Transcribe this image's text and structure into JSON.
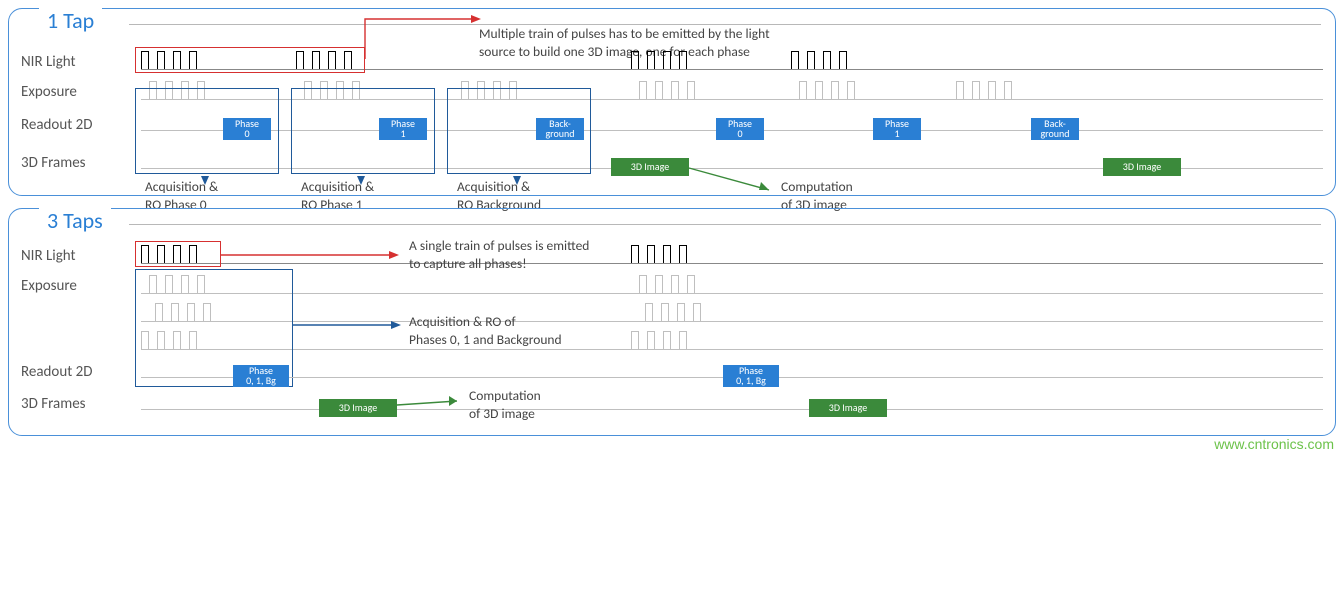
{
  "panel1": {
    "title": "1 Tap",
    "rows": {
      "nir": "NIR Light",
      "exp": "Exposure",
      "ro2d": "Readout 2D",
      "frames": "3D Frames"
    },
    "phase_labels": {
      "p0": "Phase\n0",
      "p1": "Phase\n1",
      "bg": "Back-\nground",
      "p0b": "Phase\n0",
      "p1b": "Phase\n1",
      "bgb": "Back-\nground"
    },
    "acq": {
      "a0": "Acquisition &\nRO Phase 0",
      "a1": "Acquisition &\nRO Phase 1",
      "a2": "Acquisition &\nRO Background"
    },
    "img3d": "3D Image",
    "callout_red": "Multiple train of pulses has to be emitted by the light\nsource to build one 3D image, one for each phase",
    "callout_comp": "Computation\nof 3D image"
  },
  "panel2": {
    "title": "3 Taps",
    "rows": {
      "nir": "NIR Light",
      "exp": "Exposure",
      "ro2d": "Readout 2D",
      "frames": "3D Frames"
    },
    "phase_label": "Phase\n0, 1, Bg",
    "callout_red": "A single train of pulses is emitted\nto capture all phases!",
    "acq_callout": "Acquisition & RO of\nPhases 0, 1 and Background",
    "img3d": "3D Image",
    "callout_comp": "Computation\nof 3D image"
  },
  "watermark": "www.cntronics.com"
}
